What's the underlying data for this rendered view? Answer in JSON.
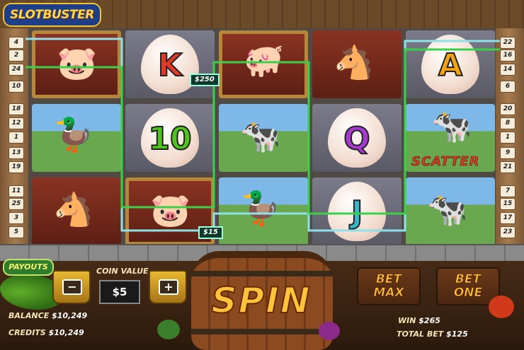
{
  "game": {
    "logo": "SLOTBUSTER"
  },
  "paylines": {
    "left": [
      "4",
      "2",
      "24",
      "10",
      "18",
      "12",
      "1",
      "13",
      "19",
      "11",
      "25",
      "3",
      "5"
    ],
    "right": [
      "22",
      "16",
      "14",
      "6",
      "20",
      "8",
      "1",
      "9",
      "21",
      "7",
      "15",
      "17",
      "23"
    ]
  },
  "reels": [
    [
      {
        "symbol": "pig-farmer"
      },
      {
        "symbol": "duck"
      },
      {
        "symbol": "horse"
      }
    ],
    [
      {
        "symbol": "egg-letter",
        "letter": "K",
        "color": "#e23a2a"
      },
      {
        "symbol": "egg-letter",
        "letter": "10",
        "color": "#4fc31e"
      },
      {
        "symbol": "pig-farmer"
      }
    ],
    [
      {
        "symbol": "pig-pitchfork"
      },
      {
        "symbol": "cow"
      },
      {
        "symbol": "duck"
      }
    ],
    [
      {
        "symbol": "horse"
      },
      {
        "symbol": "egg-letter",
        "letter": "Q",
        "color": "#a63ad0"
      },
      {
        "symbol": "egg-letter",
        "letter": "J",
        "color": "#39b5c8"
      }
    ],
    [
      {
        "symbol": "egg-letter",
        "letter": "A",
        "color": "#f2a215"
      },
      {
        "symbol": "scatter-cow",
        "label": "SCATTER"
      },
      {
        "symbol": "cow"
      }
    ]
  ],
  "wins": {
    "line_win_1": "$250",
    "line_win_2": "$15"
  },
  "controls": {
    "payouts": "PAYOUTS",
    "coin_value_label": "COIN VALUE",
    "coin_value": "$5",
    "minus": "−",
    "plus": "+",
    "spin": "SPIN",
    "bet_max_line1": "BET",
    "bet_max_line2": "MAX",
    "bet_one_line1": "BET",
    "bet_one_line2": "ONE"
  },
  "stats": {
    "balance_label": "BALANCE",
    "balance": "$10,249",
    "credits_label": "CREDITS",
    "credits": "$10,249",
    "win_label": "WIN",
    "win": "$265",
    "total_bet_label": "TOTAL BET",
    "total_bet": "$125"
  },
  "colors": {
    "payline_cyan": "#8fe0e8",
    "payline_green": "#3ad04a"
  }
}
